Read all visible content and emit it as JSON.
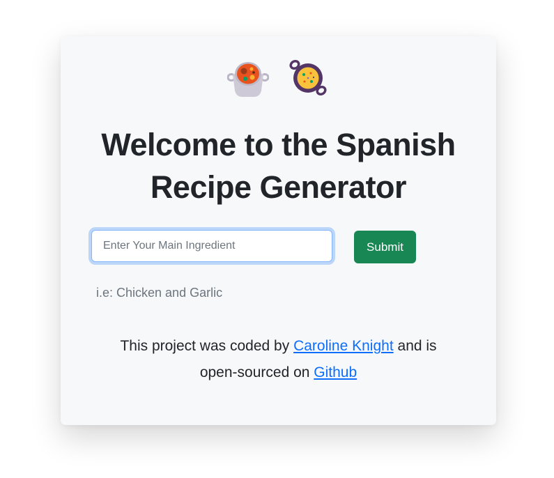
{
  "header": {
    "icons": [
      "pot-of-food-icon",
      "paella-pan-icon"
    ],
    "title_line1": "Welcome to the Spanish",
    "title_line2": "Recipe Generator"
  },
  "form": {
    "ingredient_placeholder": "Enter Your Main Ingredient",
    "ingredient_value": "",
    "submit_label": "Submit",
    "hint": "i.e: Chicken and Garlic"
  },
  "footer": {
    "text_before_author": "This project was coded by",
    "author_link": "Caroline Knight",
    "text_middle_1": "and is",
    "text_middle_2": "open-sourced on",
    "github_link": "Github"
  },
  "colors": {
    "card_background": "#f7f8fa",
    "title": "#212529",
    "submit_button": "#198754",
    "link": "#0d6efd",
    "input_focus_ring": "#86b7fe"
  }
}
